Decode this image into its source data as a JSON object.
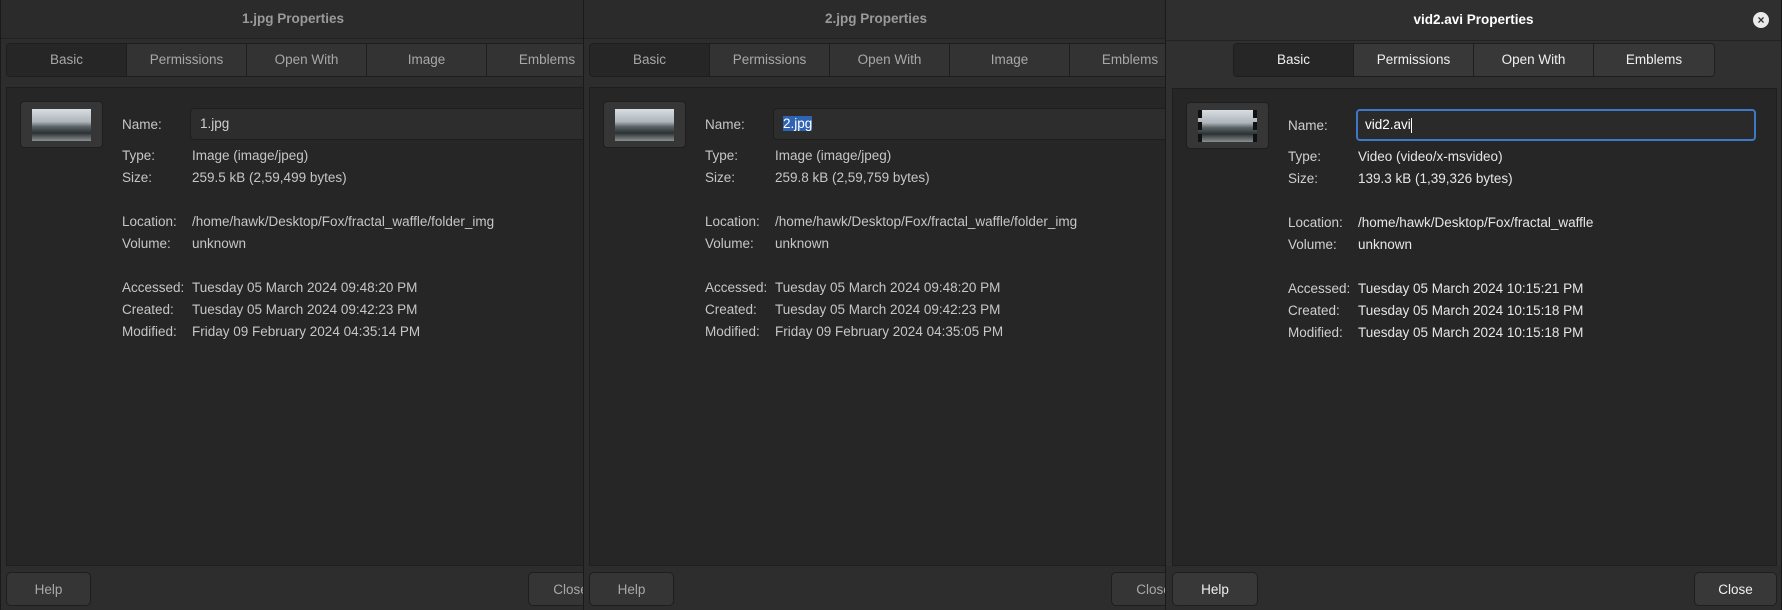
{
  "tabs_full": [
    "Basic",
    "Permissions",
    "Open With",
    "Image",
    "Emblems"
  ],
  "tabs_video": [
    "Basic",
    "Permissions",
    "Open With",
    "Emblems"
  ],
  "labels": {
    "name": "Name:",
    "type": "Type:",
    "size": "Size:",
    "location": "Location:",
    "volume": "Volume:",
    "accessed": "Accessed:",
    "created": "Created:",
    "modified": "Modified:"
  },
  "buttons": {
    "help": "Help",
    "close": "Close"
  },
  "windows": [
    {
      "title": "1.jpg Properties",
      "name": "1.jpg",
      "type": "Image (image/jpeg)",
      "size": "259.5 kB (2,59,499 bytes)",
      "location": "/home/hawk/Desktop/Fox/fractal_waffle/folder_img",
      "volume": "unknown",
      "accessed": "Tuesday 05 March 2024 09:48:20 PM",
      "created": "Tuesday 05 March 2024 09:42:23 PM",
      "modified": "Friday 09 February 2024 04:35:14 PM"
    },
    {
      "title": "2.jpg Properties",
      "name": "2.jpg",
      "type": "Image (image/jpeg)",
      "size": "259.8 kB (2,59,759 bytes)",
      "location": "/home/hawk/Desktop/Fox/fractal_waffle/folder_img",
      "volume": "unknown",
      "accessed": "Tuesday 05 March 2024 09:48:20 PM",
      "created": "Tuesday 05 March 2024 09:42:23 PM",
      "modified": "Friday 09 February 2024 04:35:05 PM"
    },
    {
      "title": "vid2.avi Properties",
      "name": "vid2.avi",
      "type": "Video (video/x-msvideo)",
      "size": "139.3 kB (1,39,326 bytes)",
      "location": "/home/hawk/Desktop/Fox/fractal_waffle",
      "volume": "unknown",
      "accessed": "Tuesday 05 March 2024 10:15:21 PM",
      "created": "Tuesday 05 March 2024 10:15:18 PM",
      "modified": "Tuesday 05 March 2024 10:15:18 PM"
    }
  ]
}
